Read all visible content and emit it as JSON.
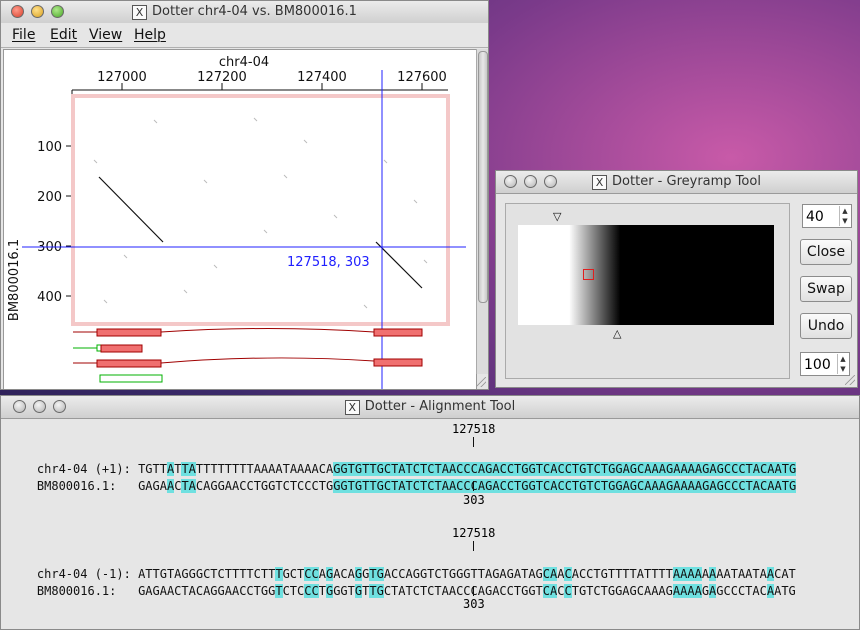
{
  "dotter_window": {
    "title": "Dotter chr4-04 vs. BM800016.1",
    "menu": [
      "File",
      "Edit",
      "View",
      "Help"
    ],
    "x_axis_label": "chr4-04",
    "y_axis_label": "BM800016.1",
    "x_ticks": [
      "127000",
      "127200",
      "127400",
      "127600"
    ],
    "y_ticks": [
      "100",
      "200",
      "300",
      "400"
    ],
    "crosshair_label": "127518, 303",
    "colors": {
      "crosshair": "#2020ff",
      "feature_fill": "#f07070",
      "feature_line": "#a00000",
      "green_feature": "#00b000"
    }
  },
  "greyramp_window": {
    "title": "Dotter - Greyramp Tool",
    "top_value": "40",
    "bottom_value": "100",
    "buttons": {
      "close": "Close",
      "swap": "Swap",
      "undo": "Undo"
    }
  },
  "alignment_window": {
    "title": "Dotter - Alignment Tool",
    "forward": {
      "top_coord": "127518",
      "ref_label": "chr4-04 (+1): ",
      "ref_seq": "TGTTATTATTTTTTTTAAAATAAAACAGGTGTTGCTATCTCTAACCCAGACCTGGTCACCTGTCTGGAGCAAAGAAAAGAGCCCTACAATG",
      "query_label": "BM800016.1:   ",
      "query_seq": "GAGAACTACAGGAACCTGGTCTCCCTGGGTGTTGCTATCTCTAACCCAGACCTGGTCACCTGTCTGGAGCAAAGAAAAGAGCCCTACAATG",
      "bottom_coord": "303"
    },
    "reverse": {
      "top_coord": "127518",
      "ref_label": "chr4-04 (-1): ",
      "ref_seq": "ATTGTAGGGCTCTTTTCTTTGCTCCAGACAGGTGACCAGGTCTGGGTTAGAGATAGCAACACCTGTTTTATTTTAAAAAAAATAATAACAT",
      "query_label": "BM800016.1:   ",
      "query_seq": "GAGAACTACAGGAACCTGGTCTCCCTGGGTGTTGCTATCTCTAACCCAGACCTGGTCACCTGTCTGGAGCAAAGAAAAGAGCCCTACAATG",
      "bottom_coord": "303"
    },
    "colors": {
      "match_highlight": "#6fe0e0"
    }
  }
}
